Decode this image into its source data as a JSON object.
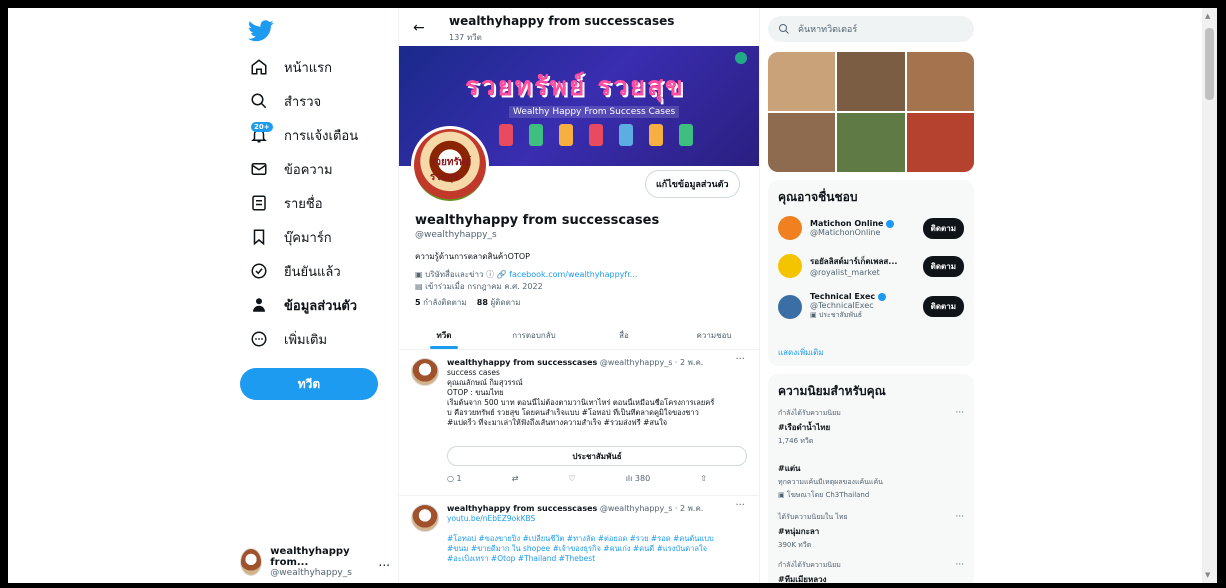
{
  "nav": {
    "items": [
      {
        "label": "หน้าแรก",
        "icon": "home-icon"
      },
      {
        "label": "สำรวจ",
        "icon": "search-icon"
      },
      {
        "label": "การแจ้งเตือน",
        "icon": "bell-icon",
        "badge": "20+"
      },
      {
        "label": "ข้อความ",
        "icon": "mail-icon"
      },
      {
        "label": "รายชื่อ",
        "icon": "list-icon"
      },
      {
        "label": "บุ๊คมาร์ก",
        "icon": "bookmark-icon"
      },
      {
        "label": "ยืนยันแล้ว",
        "icon": "verified-icon"
      },
      {
        "label": "ข้อมูลส่วนตัว",
        "icon": "profile-icon"
      },
      {
        "label": "เพิ่มเติม",
        "icon": "more-icon"
      }
    ],
    "tweet_button": "ทวีต",
    "account": {
      "name": "wealthyhappy from...",
      "handle": "@wealthyhappy_s",
      "more": "..."
    }
  },
  "header": {
    "title": "wealthyhappy from successcases",
    "count": "137 ทวีต",
    "back": "←"
  },
  "banner": {
    "title": "รวยทรัพย์ รวยสุข",
    "subtitle": "Wealthy Happy From Success Cases",
    "avatar_text": "รวยทรัพย์ รวยสุข"
  },
  "profile": {
    "edit": "แก้ไขข้อมูลส่วนตัว",
    "name": "wealthyhappy from successcases",
    "handle": "@wealthyhappy_s",
    "bio": "ความรู้ด้านการตลาดสินค้าOTOP",
    "category": "บริษัทสื่อและข่าว",
    "link": "facebook.com/wealthyhappyfr...",
    "joined": "เข้าร่วมเมื่อ กรกฎาคม ค.ศ. 2022",
    "following_count": "5",
    "following_label": "กำลังติดตาม",
    "followers_count": "88",
    "followers_label": "ผู้ติดตาม"
  },
  "tabs": [
    "ทวีต",
    "การตอบกลับ",
    "สื่อ",
    "ความชอบ"
  ],
  "tweets": [
    {
      "name": "wealthyhappy from successcases",
      "meta": "@wealthyhappy_s · 2 พ.ค.",
      "lines": [
        "success cases",
        "คุณณลักษณ์ กิมสุวรรณ์",
        "OTOP : ขนมไทย",
        "เริ่มต้นจาก 500 บาท ตอนนี้ไม่ต้องตามวานิเทาไหร่ ตอนนี้เหมือนชื่อโครงการเลยครั้",
        "บ คือรวยทรัพย์ รวยสุข โดยคนสำเร็จแบบ #โอทอป ที่เป็นทีตลาดคูมิใจของชาว",
        "#แปดริ้ว ที่จะมาเล่าให้ฟังถึงเส้นทางความสำเร็จ #รวมส่งฟรี #สนใจ"
      ],
      "cta": "ประชาสัมพันธ์",
      "replies": "1",
      "views": "380"
    },
    {
      "name": "wealthyhappy from successcases",
      "meta": "@wealthyhappy_s · 2 พ.ค.",
      "lines": [
        "youtu.be/nEbEZ9okKBS",
        "",
        "#โอทอป #ของขายปิ่ง #เปลี่ยนชีวิต #ทางลัด #ต่อยอด #รวย #รอด #คนต้นแบบ",
        "#ขนม #ขายดีมาก ใน shopee #เจ้าของธุรกิจ #คนเก่ง #คนดี #แรงบันดาลใจ",
        "#อะเบิ่งเทรา #Otop #Thailand #Thebest"
      ]
    }
  ],
  "right": {
    "search_placeholder": "ค้นหาทวิตเตอร์",
    "who_title": "คุณอาจชื่นชอบ",
    "who": [
      {
        "name": "Matichon Online",
        "handle": "@MatichonOnline",
        "follow": "ติดตาม",
        "color": "#f08020"
      },
      {
        "name": "รอยัลลิสต์มาร์เก็ตเพลส...",
        "handle": "@royalist_market",
        "follow": "ติดตาม",
        "color": "#f5c400"
      },
      {
        "name": "Technical Exec",
        "handle": "@TechnicalExec",
        "promo": "ประชาสัมพันธ์",
        "follow": "ติดตาม",
        "color": "#3a6ea5"
      }
    ],
    "show_more": "แสดงเพิ่มเติม",
    "trends_title": "ความนิยมสำหรับคุณ",
    "trends": [
      {
        "context": "กำลังได้รับความนิยม",
        "title": "#เรือดำน้ำไทย",
        "count": "1,746 ทวีต"
      },
      {
        "context": "",
        "title": "#แต่น",
        "count": "ทุกความแค้นมีเหตุผลของแค้นแค้น",
        "promo": "โฆษณาโดย Ch3Thailand"
      },
      {
        "context": "ได้รับความนิยมใน ไทย",
        "title": "#หนุ่มกะลา",
        "count": "390K ทวีต"
      },
      {
        "context": "กำลังได้รับความนิยม",
        "title": "#ทีมเมียหลวง",
        "count": ""
      }
    ]
  }
}
